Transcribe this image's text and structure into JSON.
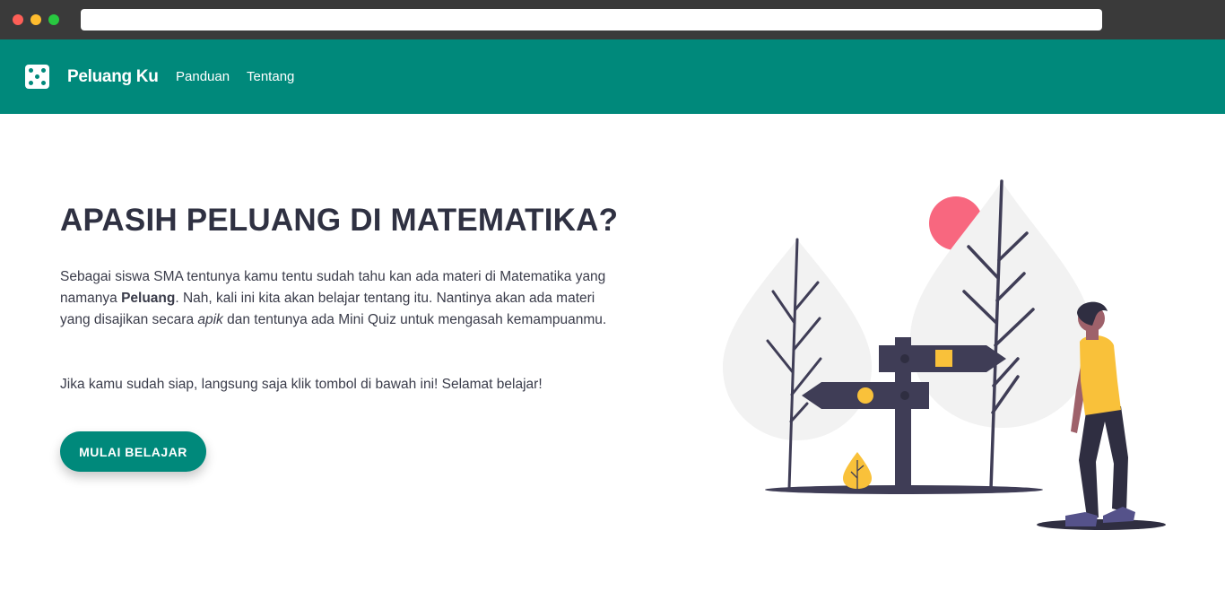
{
  "browser": {
    "address": ""
  },
  "navbar": {
    "logo_icon": "dice-icon",
    "brand": "Peluang Ku",
    "links": [
      {
        "label": "Panduan"
      },
      {
        "label": "Tentang"
      }
    ],
    "color": "#00897b"
  },
  "hero": {
    "title": "APASIH PELUANG DI MATEMATIKA?",
    "para1": {
      "t1": "Sebagai siswa SMA tentunya kamu tentu sudah tahu kan ada materi di Matematika yang namanya ",
      "bold": "Peluang",
      "t2": ". Nah, kali ini kita akan belajar tentang itu. Nantinya akan ada materi yang disajikan secara ",
      "italic": "apik",
      "t3": " dan tentunya ada Mini Quiz untuk mengasah kemampuanmu."
    },
    "para2": "Jika kamu sudah siap, langsung saja klik tombol di bawah ini! Selamat belajar!",
    "cta_label": "MULAI BELAJAR"
  },
  "illustration": {
    "name": "signpost-illustration",
    "colors": {
      "sun": "#f8677f",
      "tree": "#f2f2f2",
      "dark": "#3f3d56",
      "accent": "#f9c13a",
      "skin": "#9e616a"
    }
  }
}
